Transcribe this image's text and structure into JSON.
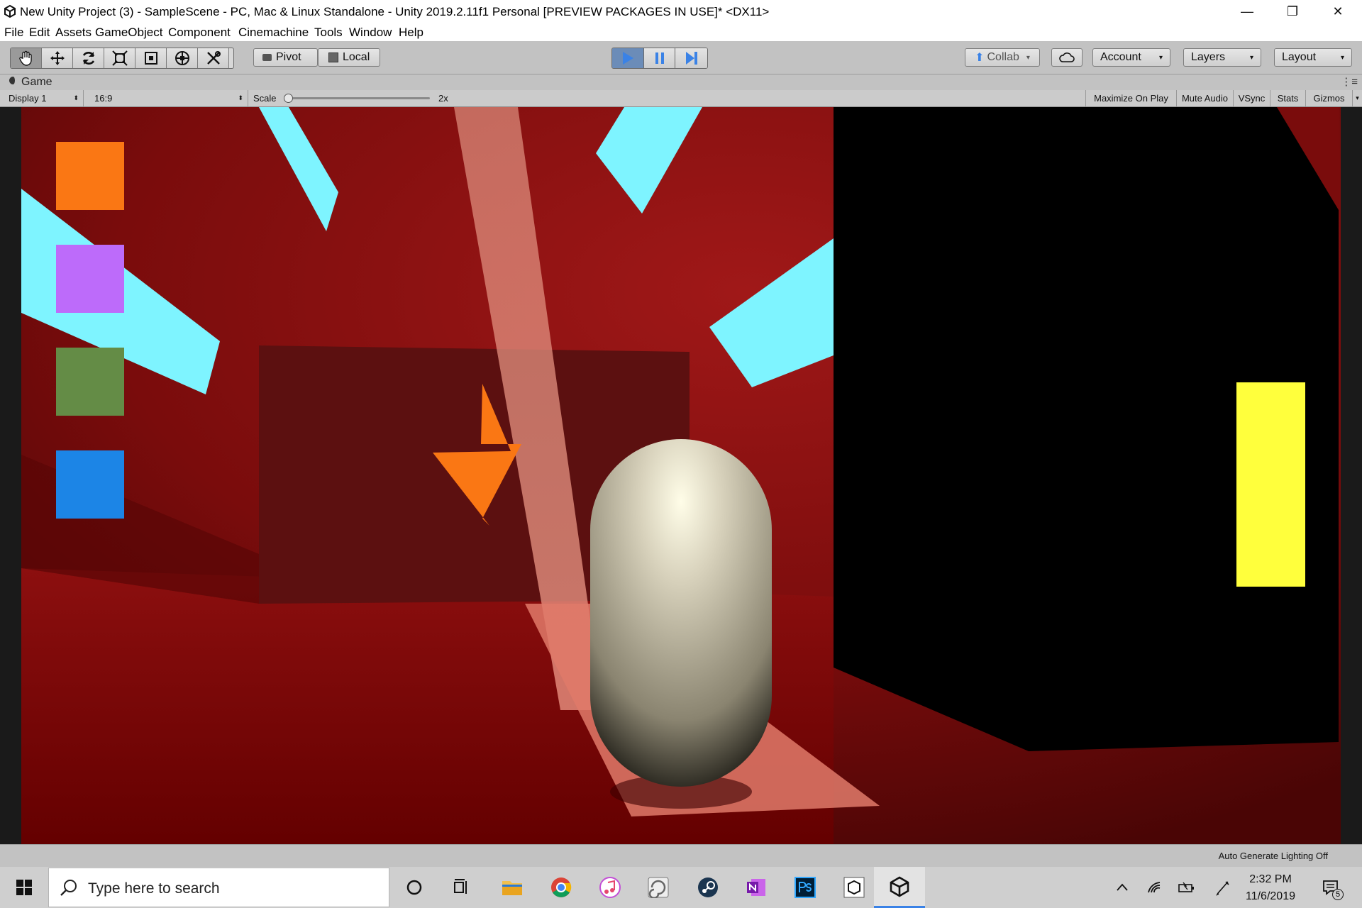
{
  "window": {
    "title": "New Unity Project (3) - SampleScene - PC, Mac & Linux Standalone - Unity 2019.2.11f1 Personal [PREVIEW PACKAGES IN USE]* <DX11>",
    "minimize": "—",
    "maximize": "❐",
    "close": "✕"
  },
  "menu": [
    "File",
    "Edit",
    "Assets",
    "GameObject",
    "Component",
    "Cinemachine",
    "Tools",
    "Window",
    "Help"
  ],
  "toolbar": {
    "pivot_label": "Pivot",
    "local_label": "Local",
    "collab_label": "Collab",
    "account_label": "Account",
    "layers_label": "Layers",
    "layout_label": "Layout"
  },
  "game_tab": {
    "title": "Game",
    "display": "Display 1",
    "aspect": "16:9",
    "scale_label": "Scale",
    "scale_value": "2x",
    "maximize_on_play": "Maximize On Play",
    "mute_audio": "Mute Audio",
    "vsync": "VSync",
    "stats": "Stats",
    "gizmos": "Gizmos"
  },
  "status_bar": {
    "lighting": "Auto Generate Lighting Off"
  },
  "taskbar": {
    "search_placeholder": "Type here to search",
    "time": "2:32 PM",
    "date": "11/6/2019",
    "notifications": "5"
  },
  "colors": {
    "play_active": "#3a82e6",
    "swatch_orange": "#fa7714",
    "swatch_purple": "#bd6bfa",
    "swatch_green": "#648c46",
    "swatch_blue": "#1c85e6",
    "yellow_bar": "#ffff3c",
    "room_red": "#6e0000",
    "sky_cyan": "#7ef4ff"
  }
}
